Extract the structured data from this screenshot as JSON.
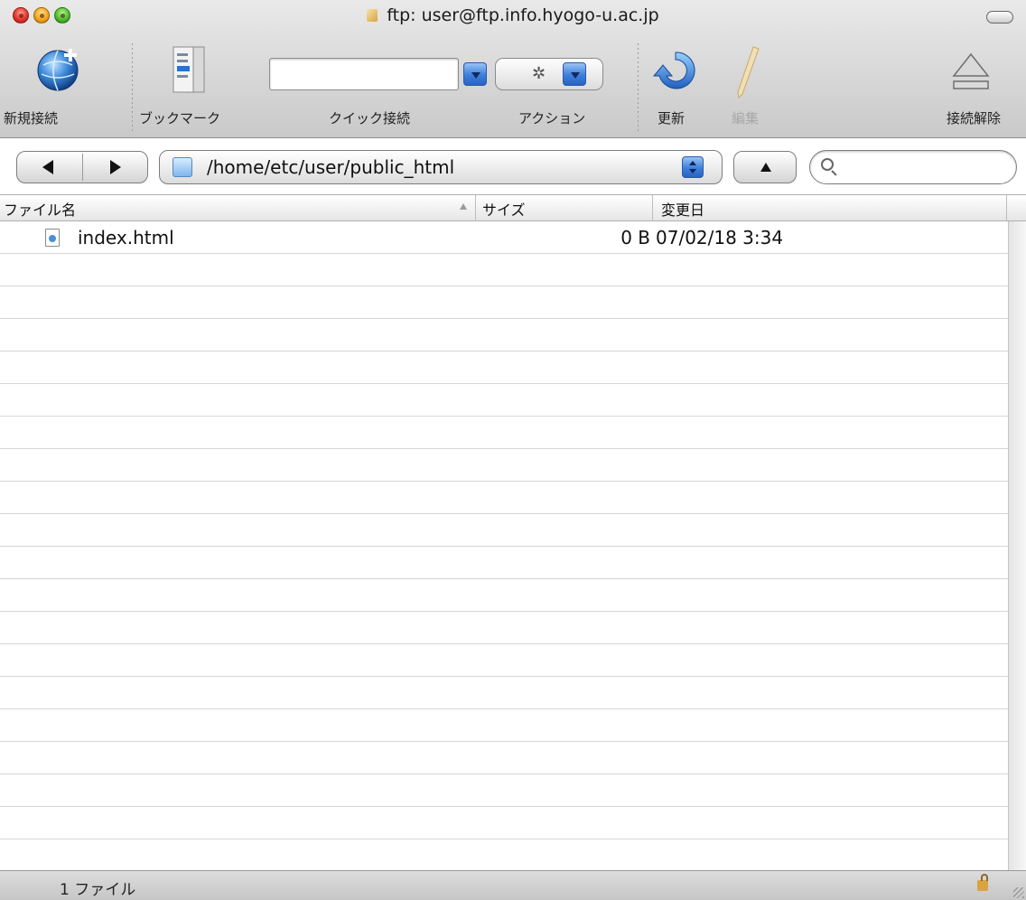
{
  "window": {
    "title": "ftp: user@ftp.info.hyogo-u.ac.jp"
  },
  "toolbar": {
    "new_connection": "新規接続",
    "bookmarks": "ブックマーク",
    "quick_connect": "クイック接続",
    "quick_connect_value": "",
    "action": "アクション",
    "refresh": "更新",
    "edit": "編集",
    "disconnect": "接続解除"
  },
  "navigation": {
    "path": "/home/etc/user/public_html",
    "search_value": ""
  },
  "file_list": {
    "columns": [
      "ファイル名",
      "サイズ",
      "変更日"
    ],
    "sort_column": "ファイル名",
    "rows": [
      {
        "name": "index.html",
        "size": "0 B",
        "modified": "07/02/18 3:34"
      }
    ]
  },
  "status": {
    "text": "1 ファイル"
  },
  "colors": {
    "accent_blue": "#3c7fdc",
    "close": "#e3342a",
    "minimize": "#f3a51d",
    "zoom": "#4fbf2b"
  }
}
